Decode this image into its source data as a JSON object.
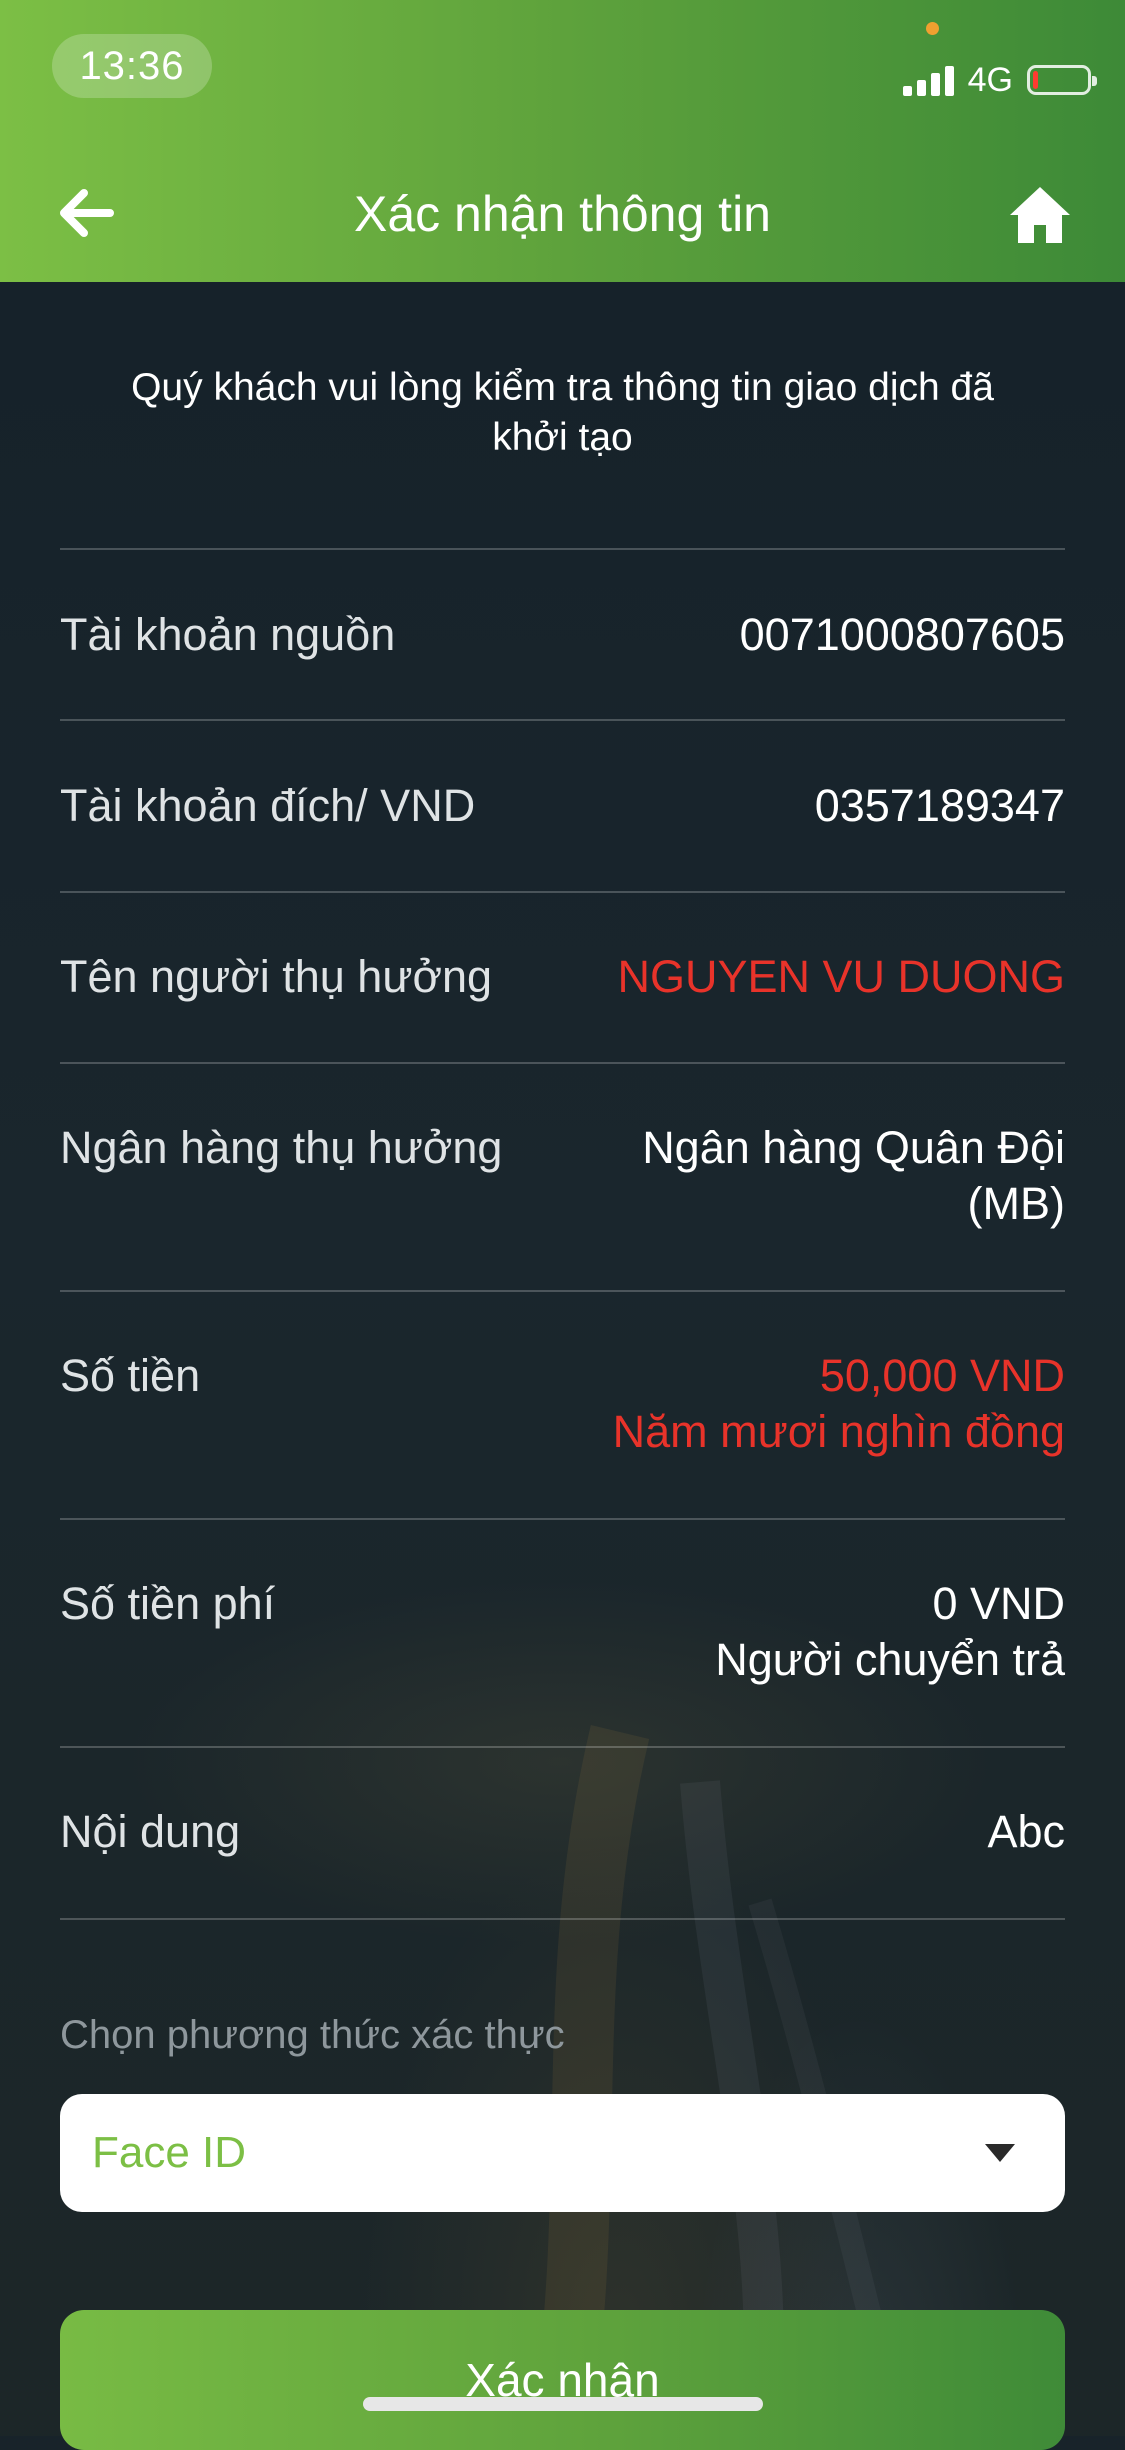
{
  "status_bar": {
    "time": "13:36",
    "network": "4G",
    "battery_level": 0.1,
    "signal_bars": 4
  },
  "header": {
    "title": "Xác nhận thông tin",
    "back_icon": "arrow-left-icon",
    "home_icon": "home-icon"
  },
  "intro": "Quý khách vui lòng kiểm tra thông tin giao dịch đã khởi tạo",
  "details": {
    "source_account": {
      "label": "Tài khoản nguồn",
      "value": "0071000807605"
    },
    "dest_account": {
      "label": "Tài khoản đích/ VND",
      "value": "0357189347"
    },
    "beneficiary_name": {
      "label": "Tên người thụ hưởng",
      "value": "NGUYEN VU DUONG"
    },
    "beneficiary_bank": {
      "label": "Ngân hàng thụ hưởng",
      "value": "Ngân hàng Quân Đội (MB)"
    },
    "amount": {
      "label": "Số tiền",
      "value": "50,000 VND",
      "sub": "Năm mươi nghìn đồng"
    },
    "fee": {
      "label": "Số tiền phí",
      "value": "0 VND",
      "sub": "Người chuyển trả"
    },
    "content": {
      "label": "Nội dung",
      "value": "Abc"
    }
  },
  "auth": {
    "label": "Chọn phương thức xác thực",
    "selected": "Face ID"
  },
  "confirm_button": "Xác nhận",
  "colors": {
    "header_green_start": "#7cbf45",
    "header_green_end": "#3d8a37",
    "highlight_red": "#e8332a",
    "background": "#18232a"
  }
}
